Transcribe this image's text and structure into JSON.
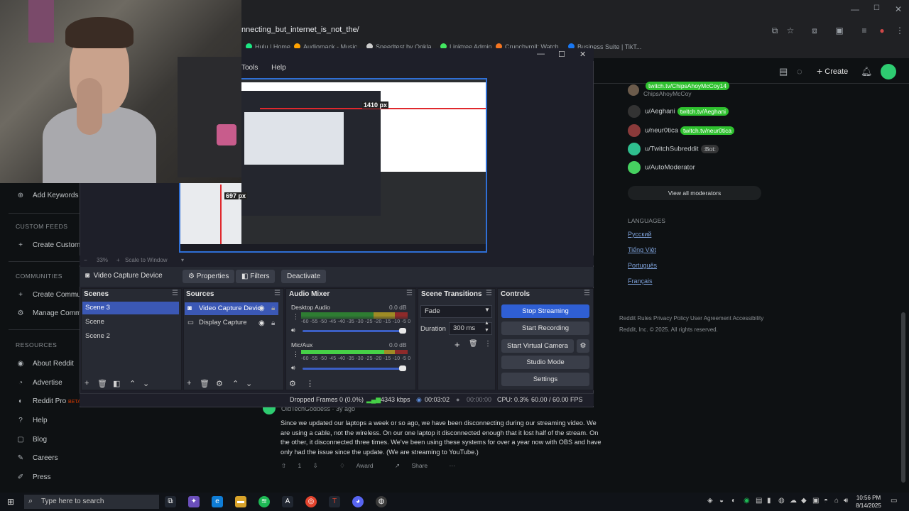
{
  "browser": {
    "url": "nnecting_but_internet_is_not_the/",
    "bookmarks": [
      "Hulu | Home",
      "Audiomack - Music",
      "Speedtest by Ookla",
      "Linktree Admin",
      "Crunchyroll: Watch...",
      "Business Suite | TikT..."
    ],
    "window_controls": {
      "minimize": "—",
      "maximize": "☐",
      "close": "✕"
    }
  },
  "reddit": {
    "header": {
      "create_label": "Create"
    },
    "sidebar": {
      "add_keywords": "Add Keywords",
      "custom_feeds_head": "CUSTOM FEEDS",
      "create_custom": "Create Custom",
      "communities_head": "COMMUNITIES",
      "create_community": "Create Commu",
      "manage_community": "Manage Comm",
      "resources_head": "RESOURCES",
      "resources": [
        "About Reddit",
        "Advertise",
        "Reddit Pro",
        "Help",
        "Blog",
        "Careers",
        "Press"
      ],
      "pro_badge": "BETA"
    },
    "moderators": [
      {
        "name": "ChipsAhoyMcCoy",
        "flair": "twitch.tv/ChipsAhoyMcCoy14",
        "color": "#6b5b4b"
      },
      {
        "name": "u/Aeghani",
        "flair": "twitch.tv/Aeghani",
        "color": "#333333"
      },
      {
        "name": "u/neur0tica",
        "flair": "twitch.tv/neur0tica",
        "color": "#8a3a3a"
      },
      {
        "name": "u/TwitchSubreddit",
        "flair": ":Bot:",
        "color": "#2fbf8f"
      },
      {
        "name": "u/AutoModerator",
        "flair": "",
        "color": "#46d160"
      }
    ],
    "view_all_mods": "View all moderators",
    "languages_head": "LANGUAGES",
    "languages": [
      "Русский",
      "Tiếng Việt",
      "Português",
      "Français"
    ],
    "footer_links": "Reddit Rules   Privacy Policy   User Agreement   Accessibility",
    "copyright": "Reddit, Inc. © 2025. All rights reserved.",
    "comment": {
      "user": "OldTechGoddess · 3y ago",
      "body": "Since we updated our laptops a week or so ago, we have been disconnecting during our streaming video. We are using a cable, not the wireless. On our one laptop it disconnected enough that it lost half of the stream. On the other, it disconnected three times. We've been using these systems for over a year now with OBS and have only had the issue since the update. (We are streaming to YouTube.)",
      "votes": "1",
      "award": "Award",
      "share": "Share",
      "more": "···"
    }
  },
  "obs": {
    "menu": [
      "Tools",
      "Help"
    ],
    "window_controls": {
      "minimize": "—",
      "maximize": "☐",
      "close": "✕"
    },
    "preview": {
      "dim_width": "1410 px",
      "dim_height": "697 px"
    },
    "zoom": {
      "level": "33%",
      "mode": "Scale to Window"
    },
    "context": {
      "source_name": "Video Capture Device",
      "properties": "Properties",
      "filters": "Filters",
      "deactivate": "Deactivate"
    },
    "scenes": {
      "title": "Scenes",
      "items": [
        "Scene 3",
        "Scene",
        "Scene 2"
      ],
      "active_index": 0
    },
    "sources": {
      "title": "Sources",
      "items": [
        "Video Capture Devic",
        "Display Capture"
      ]
    },
    "mixer": {
      "title": "Audio Mixer",
      "channels": [
        {
          "name": "Desktop Audio",
          "db": "0.0 dB",
          "level": 0.0
        },
        {
          "name": "Mic/Aux",
          "db": "0.0 dB",
          "level": 0.78
        }
      ],
      "ticks": "-60 -55 -50 -45 -40 -35 -30 -25 -20 -15 -10 -5 0"
    },
    "transitions": {
      "title": "Scene Transitions",
      "selected": "Fade",
      "duration_label": "Duration",
      "duration": "300 ms"
    },
    "controls": {
      "title": "Controls",
      "stop_streaming": "Stop Streaming",
      "start_recording": "Start Recording",
      "start_virtual_camera": "Start Virtual Camera",
      "studio_mode": "Studio Mode",
      "settings": "Settings"
    },
    "status": {
      "dropped": "Dropped Frames 0 (0.0%)",
      "bitrate": "4343 kbps",
      "stream_time": "00:03:02",
      "rec_time": "00:00:00",
      "cpu": "CPU: 0.3%",
      "fps": "60.00 / 60.00 FPS"
    }
  },
  "taskbar": {
    "search_placeholder": "Type here to search",
    "clock_time": "10:56 PM",
    "clock_date": "8/14/2025",
    "accent": "#3b58b5"
  }
}
